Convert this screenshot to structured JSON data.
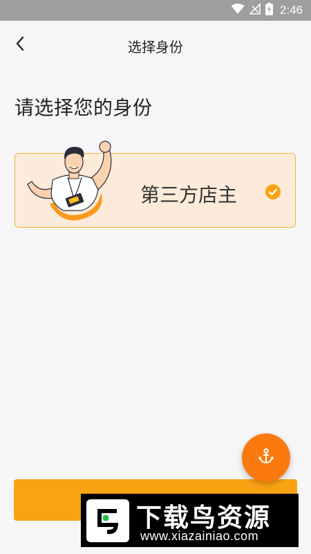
{
  "status_bar": {
    "time": "2:46",
    "icons": [
      "wifi-icon",
      "signal-icon",
      "battery-charging-icon"
    ]
  },
  "nav": {
    "title": "选择身份",
    "back_icon": "chevron-left-icon"
  },
  "prompt": "请选择您的身份",
  "roles": [
    {
      "label": "第三方店主",
      "selected": true,
      "illustration": "shop-owner-illustration"
    }
  ],
  "fab": {
    "icon": "anchor-icon"
  },
  "bottom_button": {
    "label": ""
  },
  "watermark": {
    "text_cn": "下载鸟资源",
    "text_en": "www.xiazainiao.com"
  },
  "colors": {
    "accent": "#f9a314",
    "fab": "#fa7a0f",
    "card_bg": "#fcebda",
    "card_border": "#f5b637",
    "status_bar": "#9e9e9e"
  }
}
